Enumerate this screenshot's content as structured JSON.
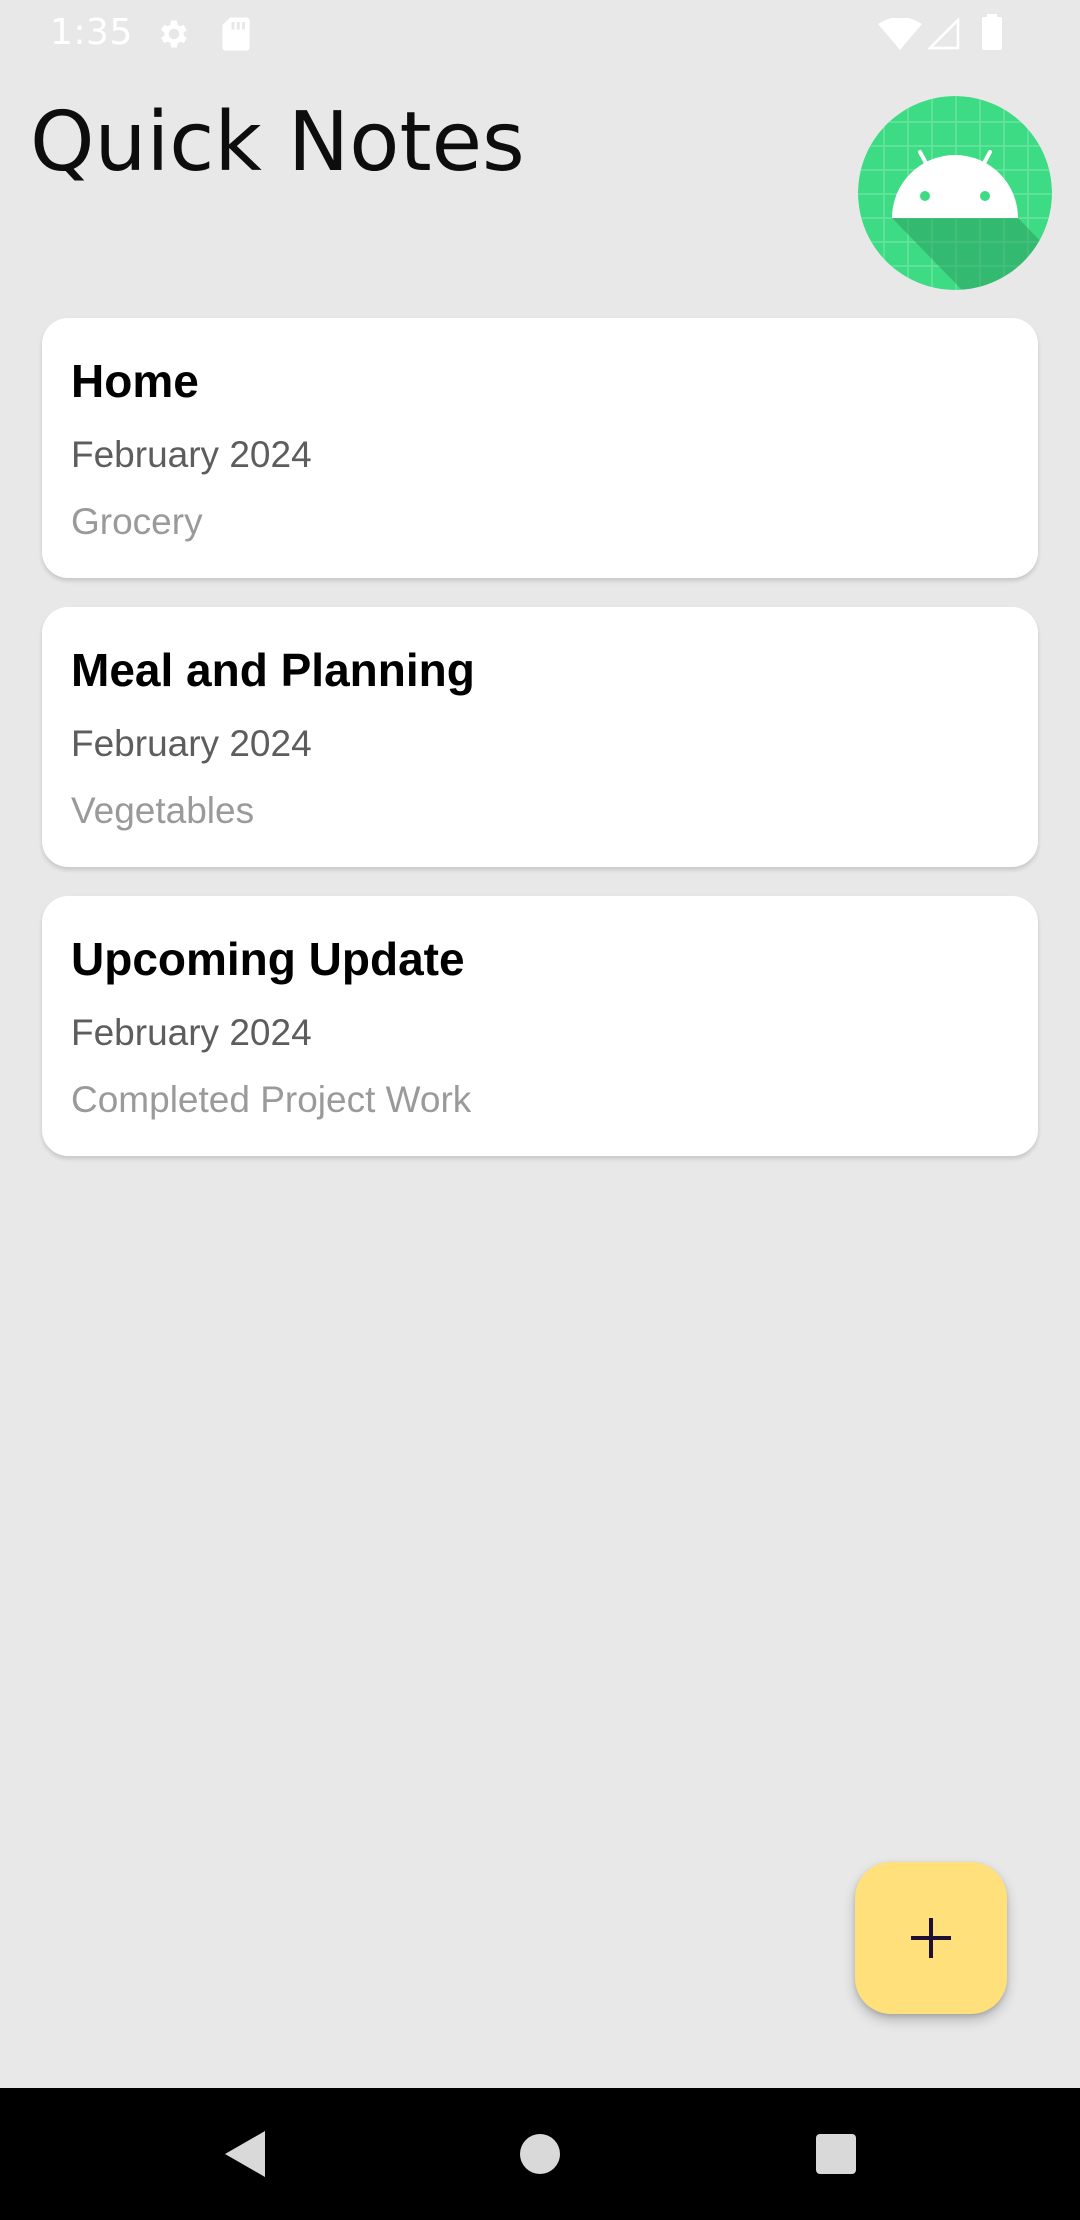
{
  "status_bar": {
    "time": "1:35",
    "icons": [
      "settings-icon",
      "sd-card-icon",
      "wifi-icon",
      "cell-signal-icon",
      "battery-icon"
    ]
  },
  "header": {
    "title": "Quick Notes",
    "avatar_icon": "android-logo-icon"
  },
  "notes": [
    {
      "title": "Home",
      "date": "February 2024",
      "description": "Grocery"
    },
    {
      "title": "Meal and Planning",
      "date": "February 2024",
      "description": "Vegetables"
    },
    {
      "title": "Upcoming Update",
      "date": "February 2024",
      "description": "Completed Project Work"
    }
  ],
  "fab": {
    "icon": "plus-icon"
  },
  "nav_bar": {
    "buttons": [
      "back-icon",
      "home-icon",
      "recents-icon"
    ]
  },
  "colors": {
    "background": "#e8e8e8",
    "card": "#ffffff",
    "fab": "#ffe07a",
    "avatar_green": "#3ddc84",
    "nav_bar": "#000000"
  }
}
